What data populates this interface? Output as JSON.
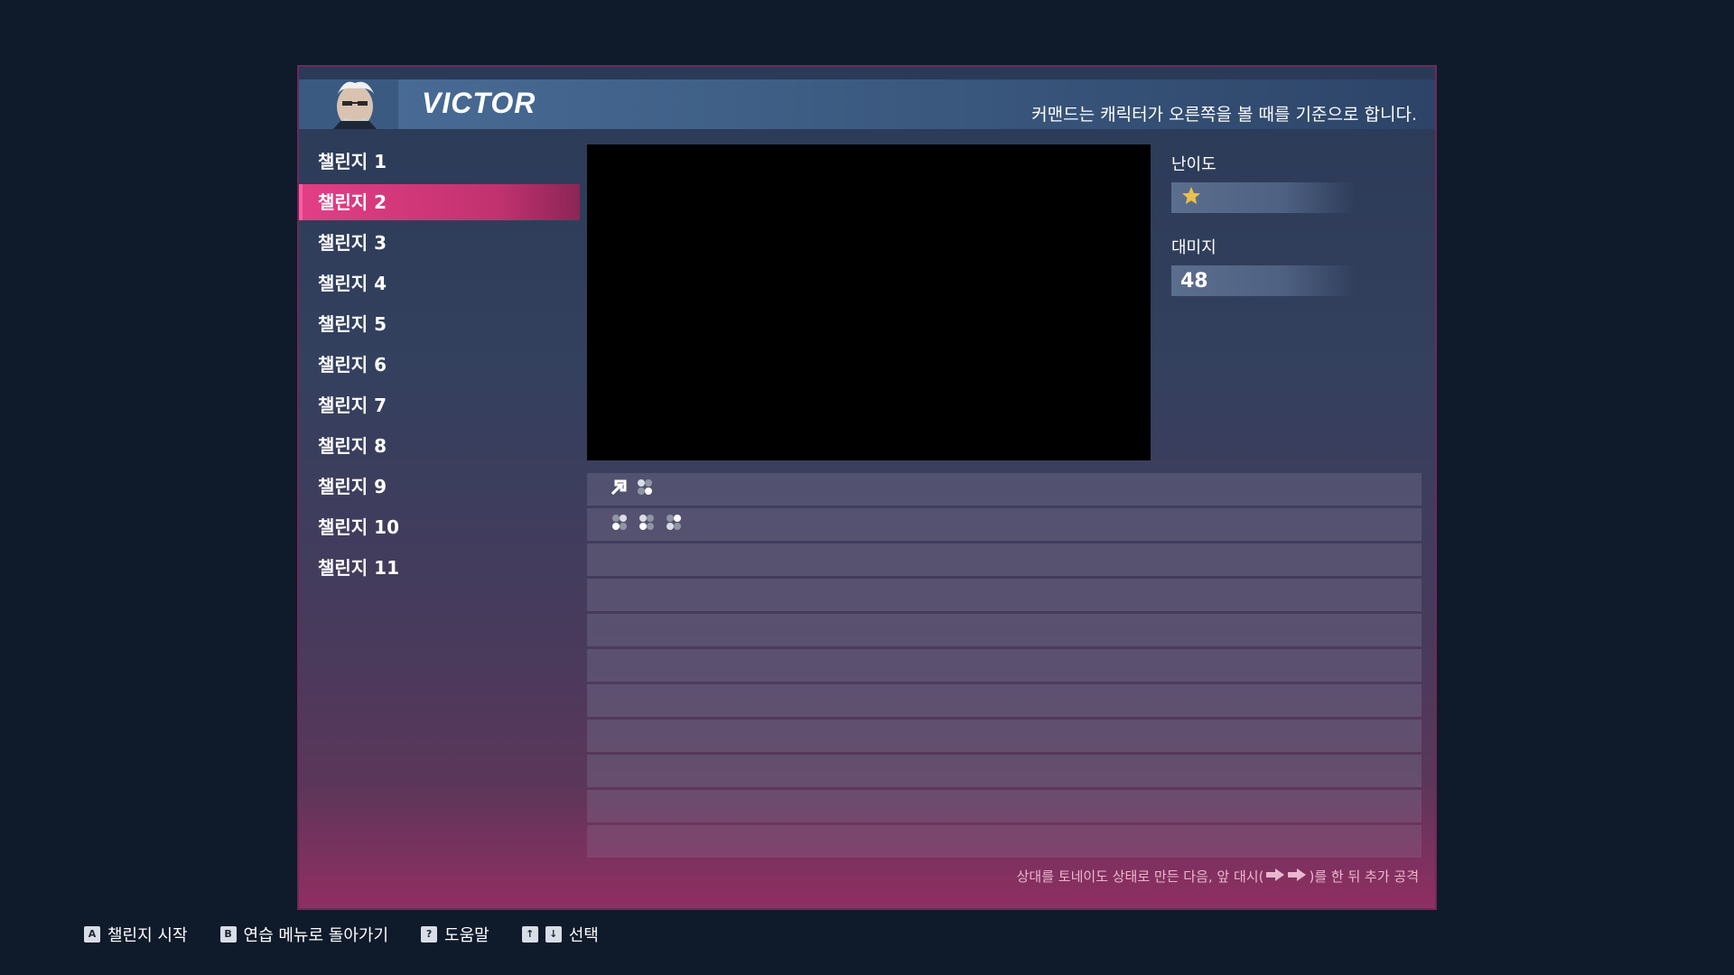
{
  "header": {
    "character_name": "VICTOR",
    "note": "커맨드는 캐릭터가 오른쪽을 볼 때를 기준으로 합니다."
  },
  "challenges": [
    {
      "label": "챌린지 1"
    },
    {
      "label": "챌린지 2",
      "selected": true
    },
    {
      "label": "챌린지 3"
    },
    {
      "label": "챌린지 4"
    },
    {
      "label": "챌린지 5"
    },
    {
      "label": "챌린지 6"
    },
    {
      "label": "챌린지 7"
    },
    {
      "label": "챌린지 8"
    },
    {
      "label": "챌린지 9"
    },
    {
      "label": "챌린지 10"
    },
    {
      "label": "챌린지 11"
    }
  ],
  "stats": {
    "difficulty_label": "난이도",
    "difficulty_stars": 1,
    "damage_label": "대미지",
    "damage_value": "48"
  },
  "commands": [
    {
      "icons": [
        "arrow-up-forward-icon",
        "button-cluster-icon"
      ]
    },
    {
      "icons": [
        "button-cluster-icon",
        "button-cluster-icon",
        "button-cluster-icon"
      ]
    },
    {
      "icons": []
    },
    {
      "icons": []
    },
    {
      "icons": []
    },
    {
      "icons": []
    },
    {
      "icons": []
    },
    {
      "icons": []
    },
    {
      "icons": []
    },
    {
      "icons": []
    },
    {
      "icons": []
    }
  ],
  "description": {
    "prefix": "상대를 토네이도 상태로 만든 다음, 앞 대시(",
    "suffix": ")를 한 뒤 추가 공격"
  },
  "bottom_hints": {
    "start": "챌린지 시작",
    "back": "연습 메뉴로 돌아가기",
    "help": "도움말",
    "select": "선택"
  },
  "colors": {
    "selected": "#e23e86",
    "star": "#e8c04a",
    "background": "#0f1a2b"
  }
}
